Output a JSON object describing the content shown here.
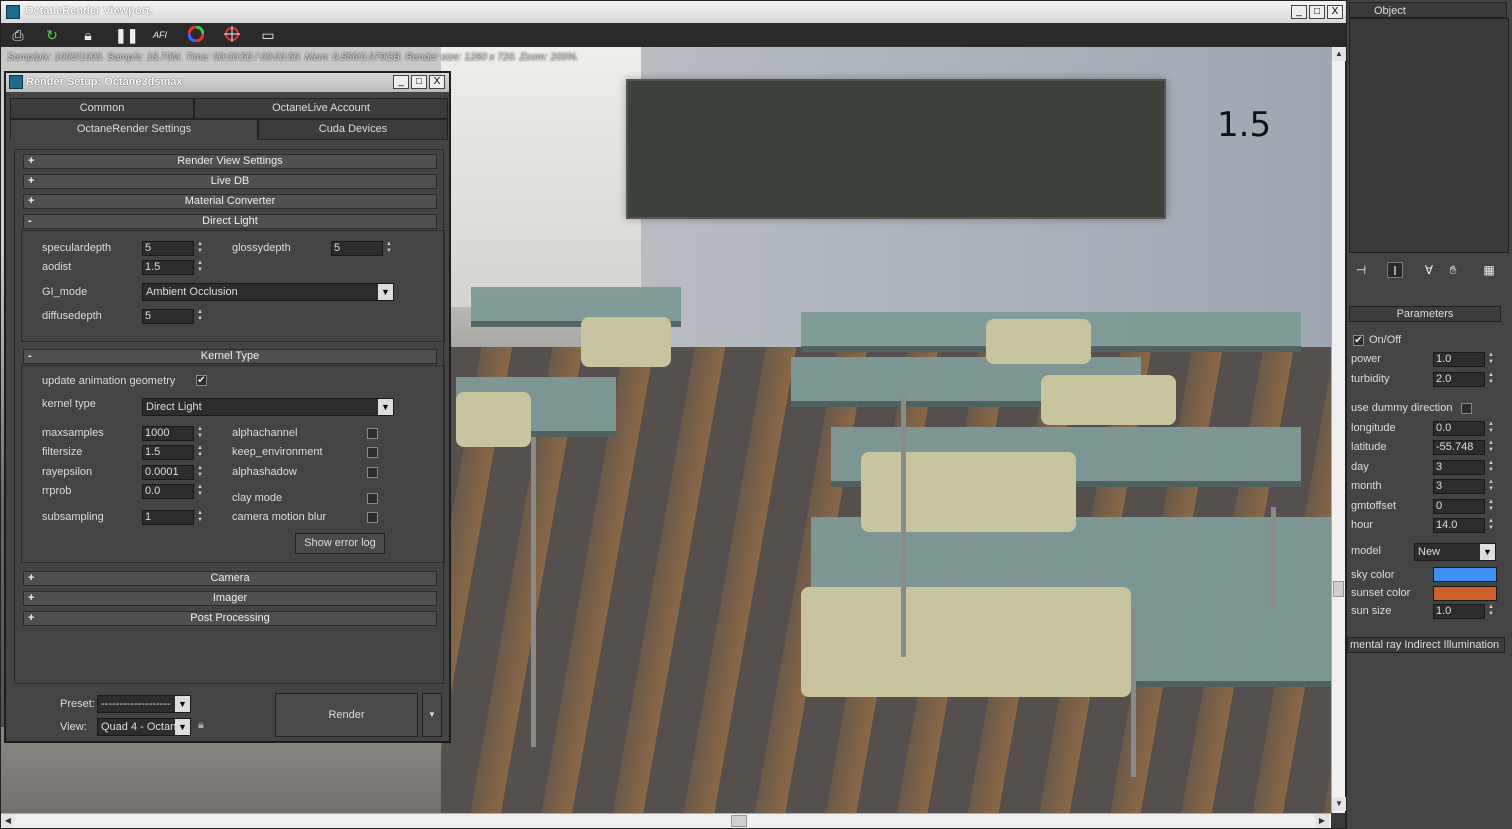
{
  "viewport": {
    "title": "OctaneRender Viewport.",
    "status": "Samp/pix: 1000/1000.  Samp/s: 18.70M.  Time: 00:00:50 / 00:00:50.  Mem: 0.856/0.979GB.  Render size: 1280 x 720.  Zoom: 200%.",
    "overlay_value": "1.5",
    "window_buttons": [
      "_",
      "□",
      "X"
    ],
    "toolbar_icons": [
      "save-image-icon",
      "restart-icon",
      "lock-icon",
      "pause-icon",
      "afi-icon",
      "color-wheel-icon",
      "focus-picker-icon",
      "display-icon"
    ],
    "afi_label": "AFI"
  },
  "render_setup": {
    "title": "Render Setup: Octane3dsmax",
    "tabs_row1": [
      "Common",
      "OctaneLive Account"
    ],
    "tabs_row2": [
      "OctaneRender Settings",
      "Cuda Devices"
    ],
    "rollouts_top": [
      {
        "sign": "+",
        "label": "Render View Settings"
      },
      {
        "sign": "+",
        "label": "Live DB"
      },
      {
        "sign": "+",
        "label": "Material Converter"
      },
      {
        "sign": "-",
        "label": "Direct Light"
      }
    ],
    "direct_light": {
      "speculardepth_label": "speculardepth",
      "speculardepth": "5",
      "glossydepth_label": "glossydepth",
      "glossydepth": "5",
      "aodist_label": "aodist",
      "aodist": "1.5",
      "gi_mode_label": "GI_mode",
      "gi_mode": "Ambient Occlusion",
      "diffusedepth_label": "diffusedepth",
      "diffusedepth": "5"
    },
    "kernel": {
      "rollout_sign": "-",
      "rollout_label": "Kernel Type",
      "update_anim_label": "update animation geometry",
      "update_anim_checked": "✔",
      "kernel_type_label": "kernel type",
      "kernel_type": "Direct Light",
      "maxsamples_label": "maxsamples",
      "maxsamples": "1000",
      "filtersize_label": "filtersize",
      "filtersize": "1.5",
      "rayepsilon_label": "rayepsilon",
      "rayepsilon": "0.0001",
      "rrprob_label": "rrprob",
      "rrprob": "0.0",
      "subsampling_label": "subsampling",
      "subsampling": "1",
      "alphachannel_label": "alphachannel",
      "keep_environment_label": "keep_environment",
      "alphashadow_label": "alphashadow",
      "clay_mode_label": "clay mode",
      "camera_motion_blur_label": "camera motion blur",
      "show_error_log": "Show error log"
    },
    "rollouts_bottom": [
      {
        "sign": "+",
        "label": "Camera"
      },
      {
        "sign": "+",
        "label": "Imager"
      },
      {
        "sign": "+",
        "label": "Post Processing"
      }
    ],
    "preset_label": "Preset:",
    "preset_value": "-------------------",
    "view_label": "View:",
    "view_value": "Quad 4 - Octan",
    "render_button": "Render"
  },
  "command_panel": {
    "object_header": "Object",
    "parameters_header": "Parameters",
    "onoff_label": "On/Off",
    "onoff_checked": "✔",
    "power_label": "power",
    "power": "1.0",
    "turbidity_label": "turbidity",
    "turbidity": "2.0",
    "use_dummy_label": "use dummy direction",
    "longitude_label": "longitude",
    "longitude": "0.0",
    "latitude_label": "latitude",
    "latitude": "-55.748",
    "day_label": "day",
    "day": "3",
    "month_label": "month",
    "month": "3",
    "gmtoffset_label": "gmtoffset",
    "gmtoffset": "0",
    "hour_label": "hour",
    "hour": "14.0",
    "model_label": "model",
    "model": "New",
    "sky_color_label": "sky color",
    "sky_color": "#3d8ff5",
    "sunset_color_label": "sunset color",
    "sunset_color": "#d0602a",
    "sun_size_label": "sun size",
    "sun_size": "1.0",
    "mental_ray_label": "mental ray Indirect Illumination"
  }
}
